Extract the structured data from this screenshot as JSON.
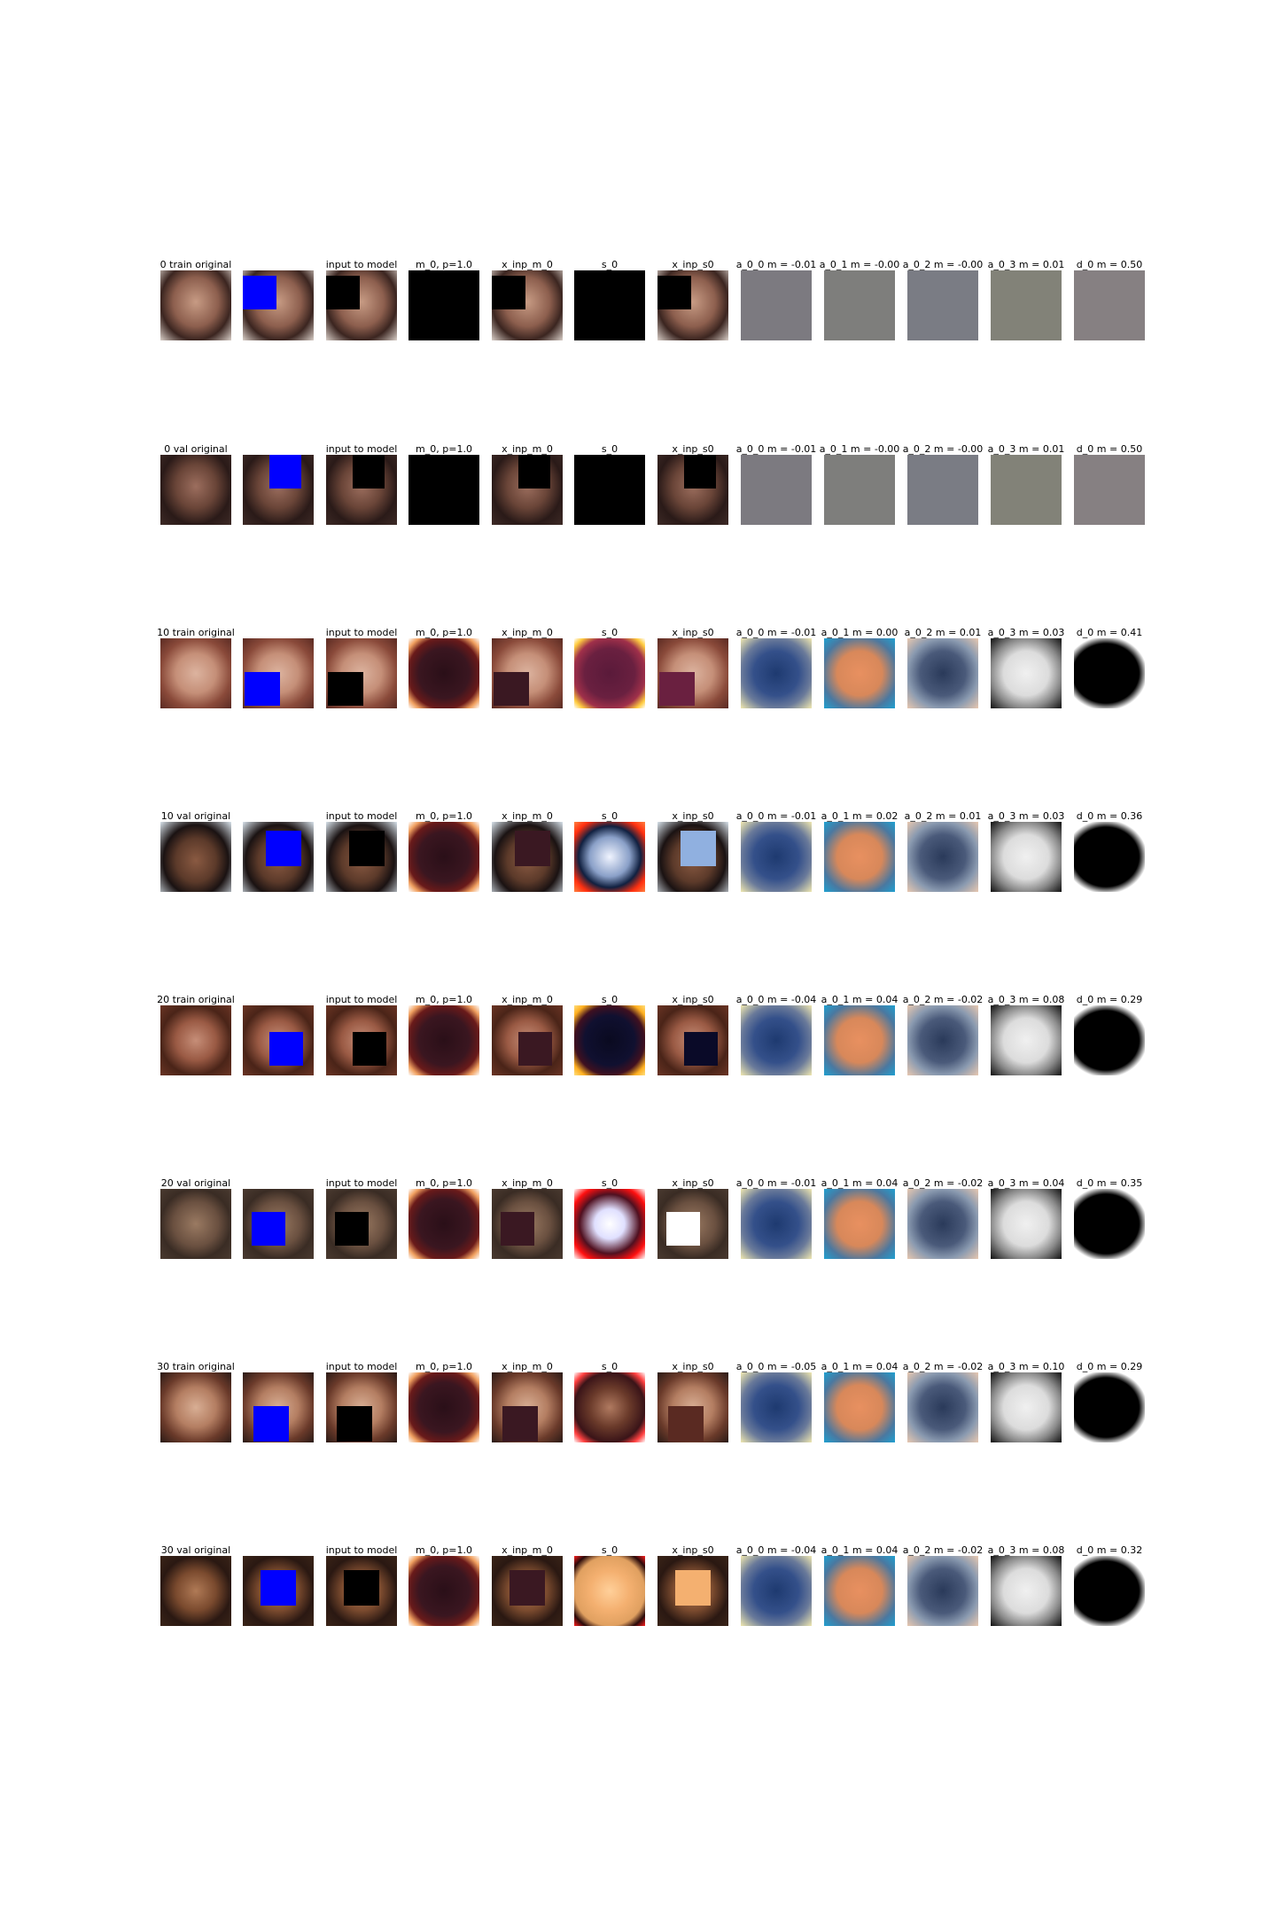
{
  "figure": {
    "columns": [
      "original",
      "",
      "input to model",
      "m_0, p=1.0",
      "x_inp_m_0",
      "s_0",
      "x_inp_s0",
      "a_0_0 m = ",
      "a_0_1 m = ",
      "a_0_2 m = ",
      "a_0_3 m = ",
      "d_0 m = "
    ],
    "rows": [
      {
        "row_label": "0 train",
        "a00": "-0.01",
        "a01": "-0.00",
        "a02": "-0.00",
        "a03": "0.01",
        "d0": "0.50"
      },
      {
        "row_label": "0 val",
        "a00": "-0.01",
        "a01": "-0.00",
        "a02": "-0.00",
        "a03": "0.01",
        "d0": "0.50"
      },
      {
        "row_label": "10 train",
        "a00": "-0.01",
        "a01": "0.00",
        "a02": "0.01",
        "a03": "0.03",
        "d0": "0.41"
      },
      {
        "row_label": "10 val",
        "a00": "-0.01",
        "a01": "0.02",
        "a02": "0.01",
        "a03": "0.03",
        "d0": "0.36"
      },
      {
        "row_label": "20 train",
        "a00": "-0.04",
        "a01": "0.04",
        "a02": "-0.02",
        "a03": "0.08",
        "d0": "0.29"
      },
      {
        "row_label": "20 val",
        "a00": "-0.01",
        "a01": "0.04",
        "a02": "-0.02",
        "a03": "0.04",
        "d0": "0.35"
      },
      {
        "row_label": "30 train",
        "a00": "-0.05",
        "a01": "0.04",
        "a02": "-0.02",
        "a03": "0.10",
        "d0": "0.29"
      },
      {
        "row_label": "30 val",
        "a00": "-0.04",
        "a01": "0.04",
        "a02": "-0.02",
        "a03": "0.08",
        "d0": "0.32"
      }
    ],
    "colors": {
      "occluder_blue": "#0000ff",
      "occluder_black": "#000000",
      "gray_tile": "#7d7b80"
    }
  }
}
